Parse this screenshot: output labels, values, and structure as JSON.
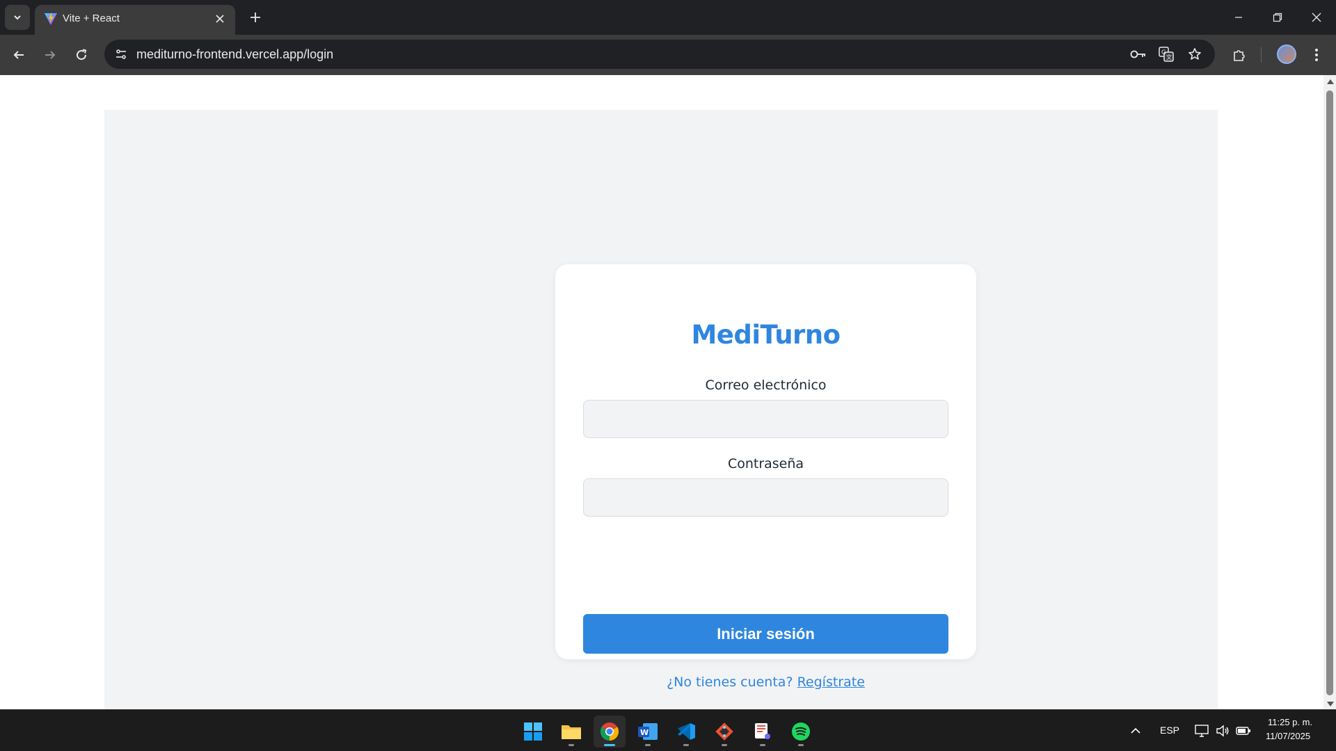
{
  "browser": {
    "tab_title": "Vite + React",
    "url": "mediturno-frontend.vercel.app/login"
  },
  "login": {
    "brand": "MediTurno",
    "email_label": "Correo electrónico",
    "email_value": "",
    "password_label": "Contraseña",
    "password_value": "",
    "submit_label": "Iniciar sesión",
    "register_prompt": "¿No tienes cuenta?",
    "register_link": "Regístrate"
  },
  "taskbar": {
    "apps": [
      "start-icon",
      "file-explorer-icon",
      "chrome-icon",
      "word-icon",
      "vscode-icon",
      "git-icon",
      "snipping-icon",
      "spotify-icon"
    ],
    "language": "ESP",
    "time": "11:25 p. m.",
    "date": "11/07/2025"
  },
  "colors": {
    "accent": "#2f86de",
    "page_background": "#f2f3f5",
    "card": "#ffffff",
    "browser_dark": "#202124",
    "toolbar": "#3c3c3c"
  }
}
